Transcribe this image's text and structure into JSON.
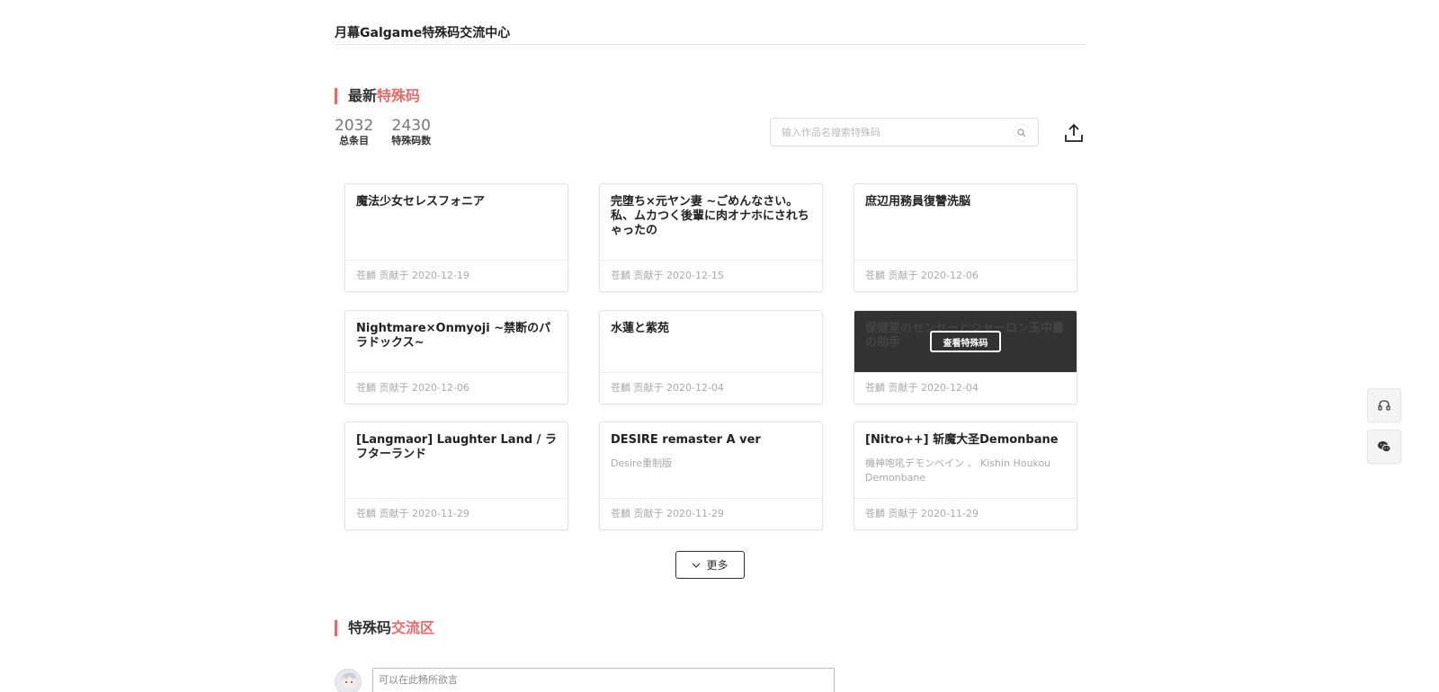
{
  "header": {
    "site_title": "月幕Galgame特殊码交流中心"
  },
  "latest_section": {
    "heading_prefix": "最新",
    "heading_accent": "特殊码",
    "stats": [
      {
        "value": "2032",
        "label": "总条目"
      },
      {
        "value": "2430",
        "label": "特殊码数"
      }
    ],
    "search": {
      "placeholder": "输入作品名搜索特殊码"
    },
    "cards": [
      {
        "title": "魔法少女セレスフォニア",
        "subtitle": "",
        "footer": "苍麟 贡献于 2020-12-19"
      },
      {
        "title": "完堕ち×元ヤン妻 ~ごめんなさい。私、ムカつく後輩に肉オナホにされちゃったの",
        "subtitle": "",
        "footer": "苍麟 贡献于 2020-12-15"
      },
      {
        "title": "庶辺用務員復讐洗脳",
        "subtitle": "",
        "footer": "苍麟 贡献于 2020-12-06"
      },
      {
        "title": "Nightmare×Onmyoji ~禁断のパラドックス~",
        "subtitle": "",
        "footer": "苍麟 贡献于 2020-12-06"
      },
      {
        "title": "水蓮と紫苑",
        "subtitle": "",
        "footer": "苍麟 贡献于 2020-12-04"
      },
      {
        "title": "保健室のセンセーとシャーロン玉中畫の助手",
        "subtitle": "",
        "footer": "苍麟 贡献于 2020-12-04",
        "hover_label": "查看特殊码"
      },
      {
        "title": "[Langmaor] Laughter Land / ラフターランド",
        "subtitle": "",
        "footer": "苍麟 贡献于 2020-11-29"
      },
      {
        "title": "DESIRE remaster A ver",
        "subtitle": "Desire重制版",
        "footer": "苍麟 贡献于 2020-11-29"
      },
      {
        "title": "[Nitro++] 斩魔大圣Demonbane",
        "subtitle": "機神咆吼デモンベイン 、 Kishin Houkou Demonbane",
        "footer": "苍麟 贡献于 2020-11-29"
      }
    ],
    "more_label": "更多"
  },
  "forum_section": {
    "heading_prefix": "特殊码",
    "heading_accent": "交流区",
    "comment_placeholder": "可以在此畅所欲言"
  },
  "icons": {
    "search": "search-icon",
    "upload": "upload-icon",
    "more": "chevron-down-icon",
    "support": "headset-icon",
    "wechat": "wechat-icon"
  },
  "colors": {
    "accent": "#e86a6a",
    "overlay": "#222222"
  }
}
